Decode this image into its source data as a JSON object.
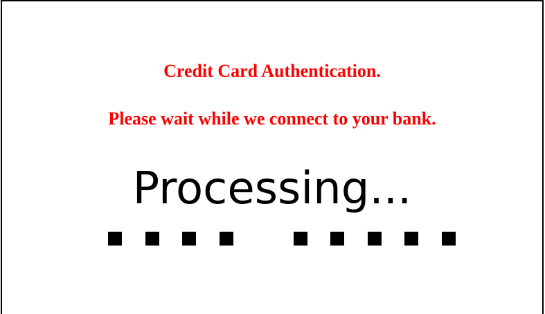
{
  "colors": {
    "message": "#ff0000",
    "processing": "#000000",
    "progress_block": "#000000"
  },
  "messages": {
    "title": "Credit Card Authentication.",
    "subtitle": "Please wait while we connect to your bank."
  },
  "status": {
    "label": "Processing..."
  },
  "progress": {
    "blocks_total": 10,
    "blocks_filled": 9,
    "missing_block_index": 4
  }
}
